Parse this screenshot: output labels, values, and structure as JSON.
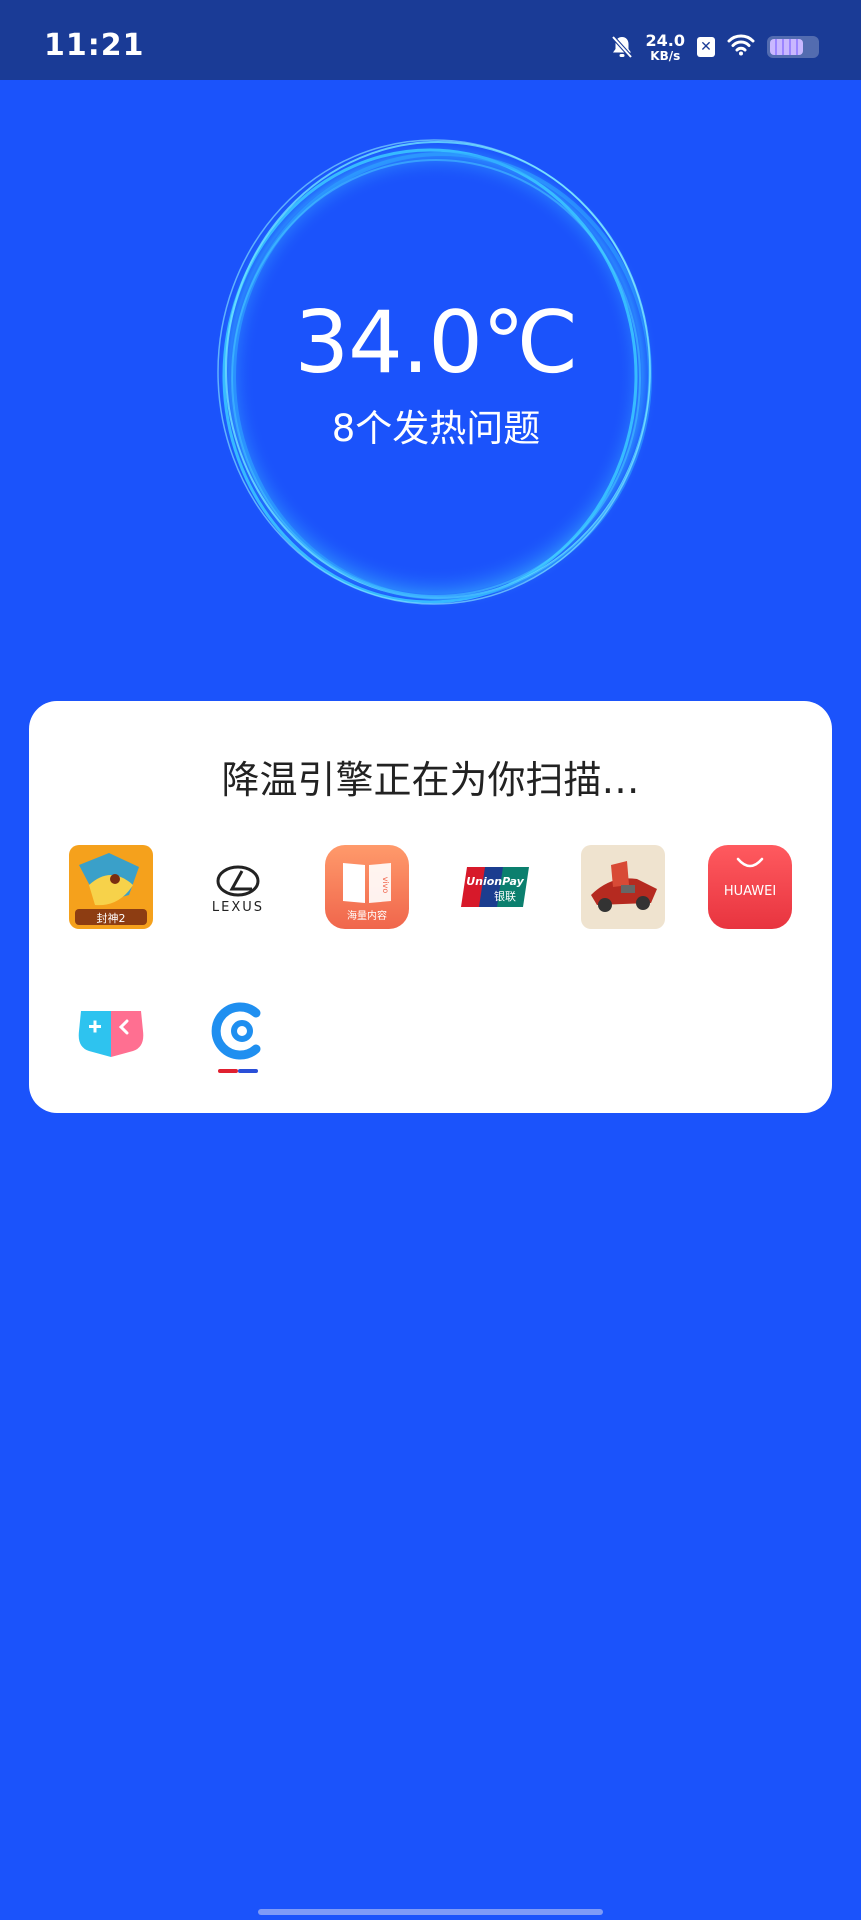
{
  "status_bar": {
    "time": "11:21",
    "net_speed_value": "24.0",
    "net_speed_unit": "KB/s",
    "battery_level": 0.72,
    "icons": [
      "mute-icon",
      "nfc-icon",
      "wifi-icon",
      "battery-icon"
    ]
  },
  "temperature": {
    "value": "34.0℃",
    "subtitle": "8个发热问题"
  },
  "scan_card": {
    "title": "降温引擎正在为你扫描…",
    "apps": [
      {
        "icon": "dragon-game-icon",
        "text": "封神2"
      },
      {
        "icon": "lexus-icon",
        "text": "LEXUS"
      },
      {
        "icon": "vivo-reader-icon",
        "text": "海量内容",
        "side_text": "vivo"
      },
      {
        "icon": "unionpay-icon",
        "text": "UnionPay",
        "sub_text": "银联"
      },
      {
        "icon": "car-game-icon"
      },
      {
        "icon": "huawei-appgallery-icon",
        "text": "HUAWEI"
      },
      {
        "icon": "game-center-icon"
      },
      {
        "icon": "c-app-icon"
      }
    ]
  },
  "colors": {
    "background": "#1b53fb",
    "status_bar": "#1a3b96",
    "ring": "#4fd2ff",
    "card": "#ffffff"
  }
}
